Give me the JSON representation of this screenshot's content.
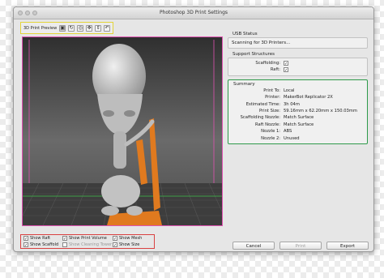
{
  "window": {
    "title": "Photoshop 3D Print Settings"
  },
  "toolbar": {
    "label": "3D Print Preview",
    "icons": [
      "cube-view-icon",
      "rotate-icon",
      "roll-icon",
      "pan-icon",
      "slide-icon",
      "undo-icon"
    ]
  },
  "usb": {
    "title": "USB Status",
    "status": "Scanning for 3D Printers..."
  },
  "support": {
    "title": "Support Structures",
    "items": [
      {
        "label": "Scaffolding:",
        "checked": true
      },
      {
        "label": "Raft:",
        "checked": true
      }
    ]
  },
  "summary": {
    "title": "Summary",
    "rows": [
      {
        "key": "Print To:",
        "value": "Local"
      },
      {
        "key": "Printer:",
        "value": "MakerBot Replicator 2X"
      },
      {
        "key": "Estimated Time:",
        "value": "3h 04m"
      },
      {
        "key": "Print Size:",
        "value": "59.16mm x 62.20mm x 150.03mm"
      },
      {
        "key": "Scaffolding Nozzle:",
        "value": "Match Surface"
      },
      {
        "key": "Raft Nozzle:",
        "value": "Match Surface"
      },
      {
        "key": "Nozzle 1:",
        "value": "ABS"
      },
      {
        "key": "Nozzle 2:",
        "value": "Unused"
      }
    ]
  },
  "options": [
    {
      "label": "Show Raft",
      "checked": true,
      "enabled": true
    },
    {
      "label": "Show Print Volume",
      "checked": true,
      "enabled": true
    },
    {
      "label": "Show Mesh",
      "checked": true,
      "enabled": true
    },
    {
      "label": "Show Scaffold",
      "checked": true,
      "enabled": true
    },
    {
      "label": "Show Cleaning Tower",
      "checked": false,
      "enabled": false
    },
    {
      "label": "Show Size",
      "checked": true,
      "enabled": true
    }
  ],
  "buttons": {
    "cancel": "Cancel",
    "print": "Print",
    "export": "Export"
  },
  "colors": {
    "model": "#c9c9c9",
    "raft": "#e07a1f",
    "grid": "#4a4a4a",
    "print_volume_border": "#e052b2",
    "summary_border": "#2e9a4a",
    "options_border": "#d94141",
    "toolbar_border": "#e3d43a"
  }
}
